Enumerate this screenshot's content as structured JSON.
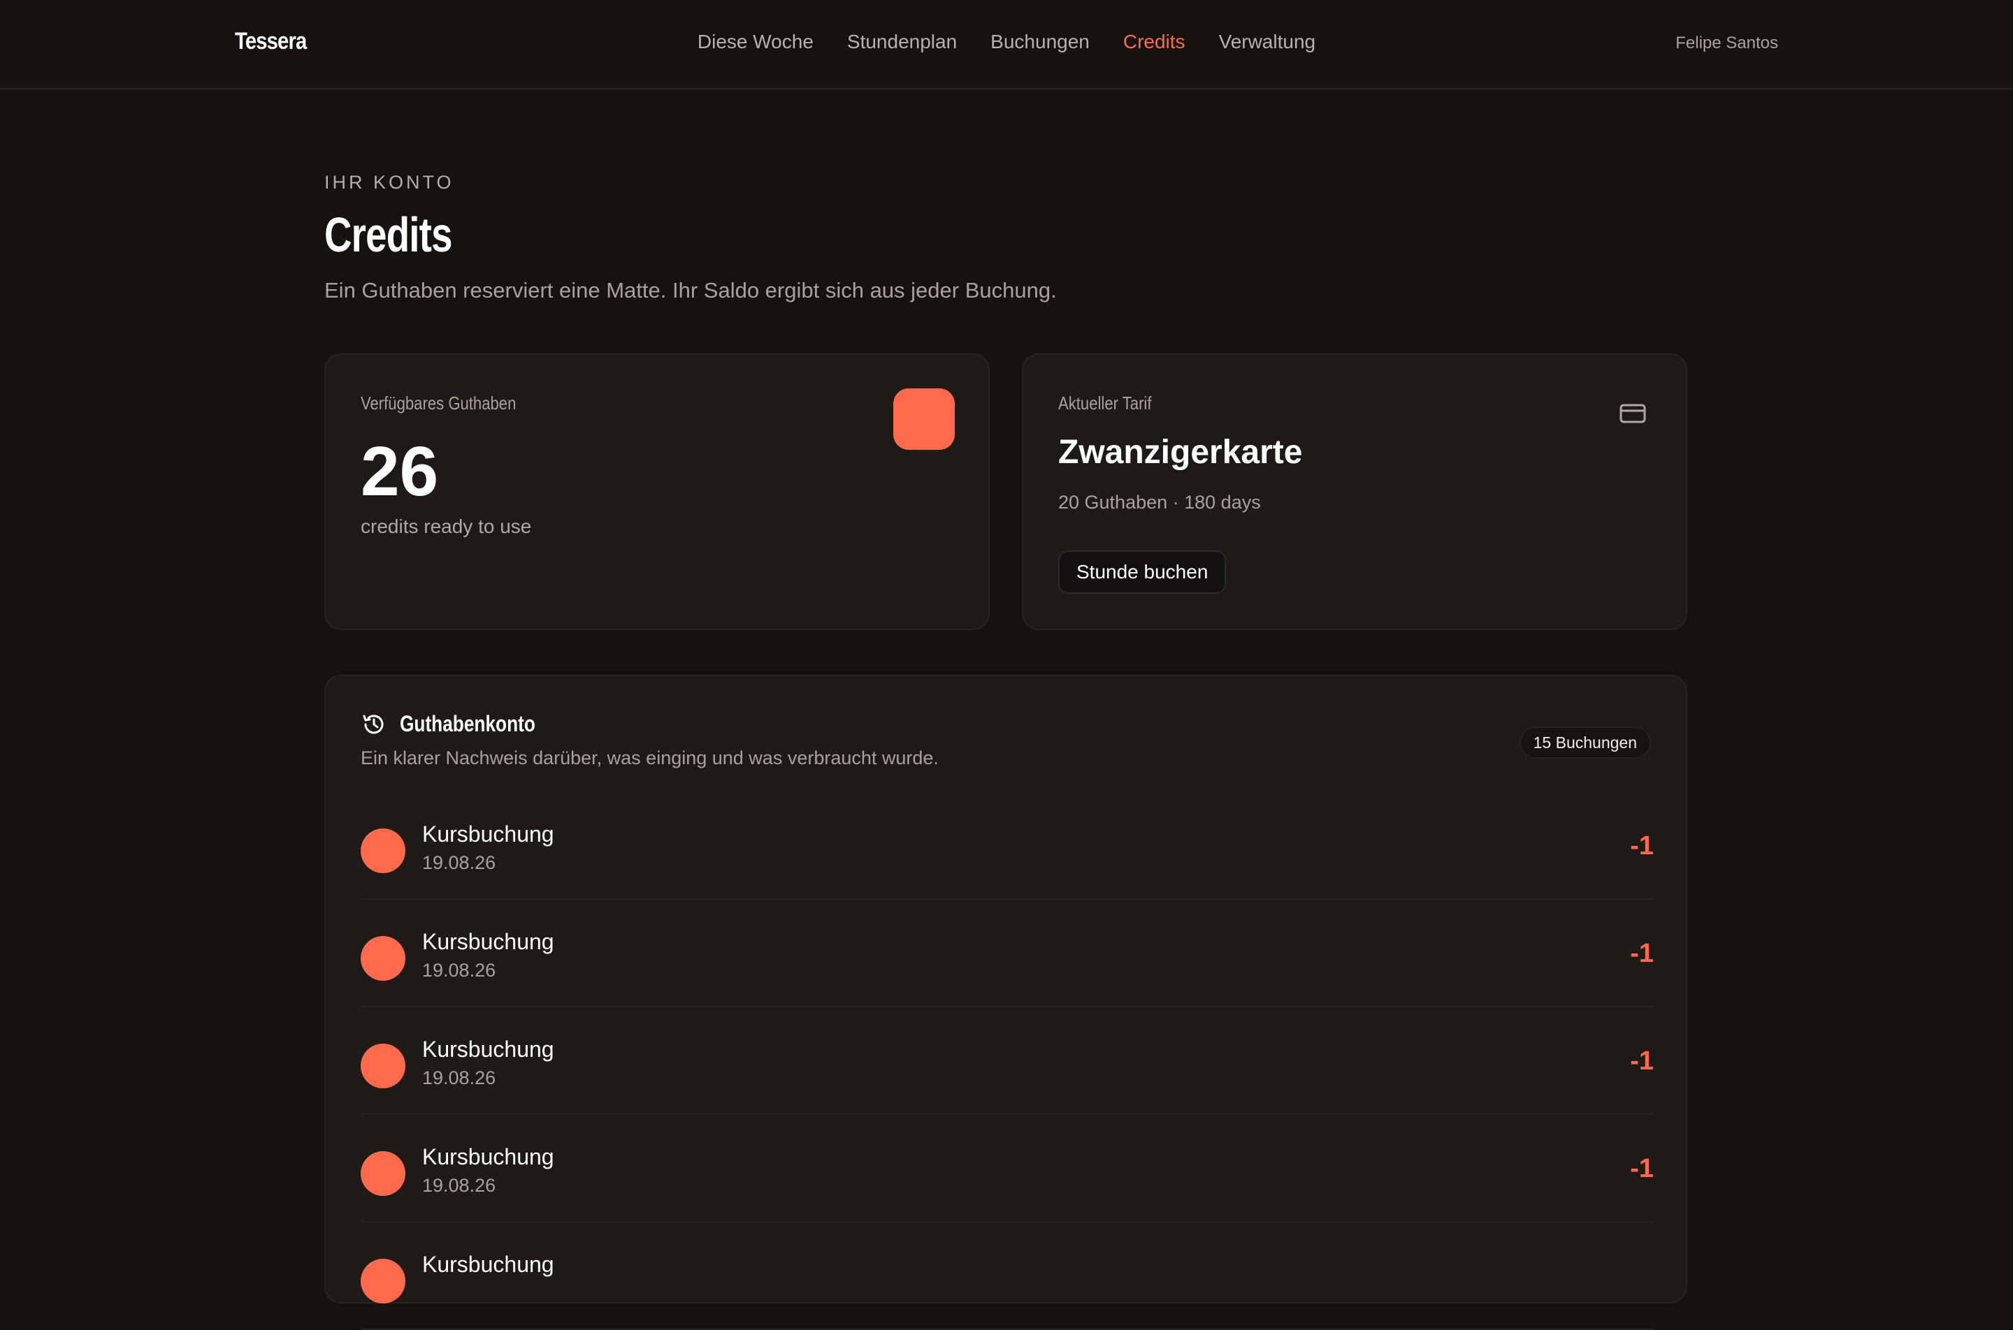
{
  "app": {
    "brand": "Tessera"
  },
  "nav": {
    "items": [
      {
        "label": "Diese Woche",
        "active": false
      },
      {
        "label": "Stundenplan",
        "active": false
      },
      {
        "label": "Buchungen",
        "active": false
      },
      {
        "label": "Credits",
        "active": true
      },
      {
        "label": "Verwaltung",
        "active": false
      }
    ],
    "user": "Felipe Santos"
  },
  "header": {
    "eyebrow": "IHR KONTO",
    "title": "Credits",
    "lead": "Ein Guthaben reserviert eine Matte. Ihr Saldo ergibt sich aus jeder Buchung."
  },
  "balance_card": {
    "label": "Verfügbares Guthaben",
    "value": "26",
    "sub": "credits ready to use"
  },
  "plan_card": {
    "label": "Aktueller Tarif",
    "name": "Zwanzigerkarte",
    "meta": "20 Guthaben · 180 days",
    "button": "Stunde buchen",
    "icon": "credit-card-icon"
  },
  "ledger": {
    "icon": "history-icon",
    "title": "Guthabenkonto",
    "subtitle": "Ein klarer Nachweis darüber, was einging und was verbraucht wurde.",
    "badge": "15 Buchungen",
    "rows": [
      {
        "title": "Kursbuchung",
        "date": "19.08.26",
        "amount": "-1"
      },
      {
        "title": "Kursbuchung",
        "date": "19.08.26",
        "amount": "-1"
      },
      {
        "title": "Kursbuchung",
        "date": "19.08.26",
        "amount": "-1"
      },
      {
        "title": "Kursbuchung",
        "date": "19.08.26",
        "amount": "-1"
      },
      {
        "title": "Kursbuchung",
        "date": "",
        "amount": ""
      }
    ]
  },
  "colors": {
    "accent": "#ff6a4d",
    "background": "#151210",
    "card": "#1e1a18"
  }
}
